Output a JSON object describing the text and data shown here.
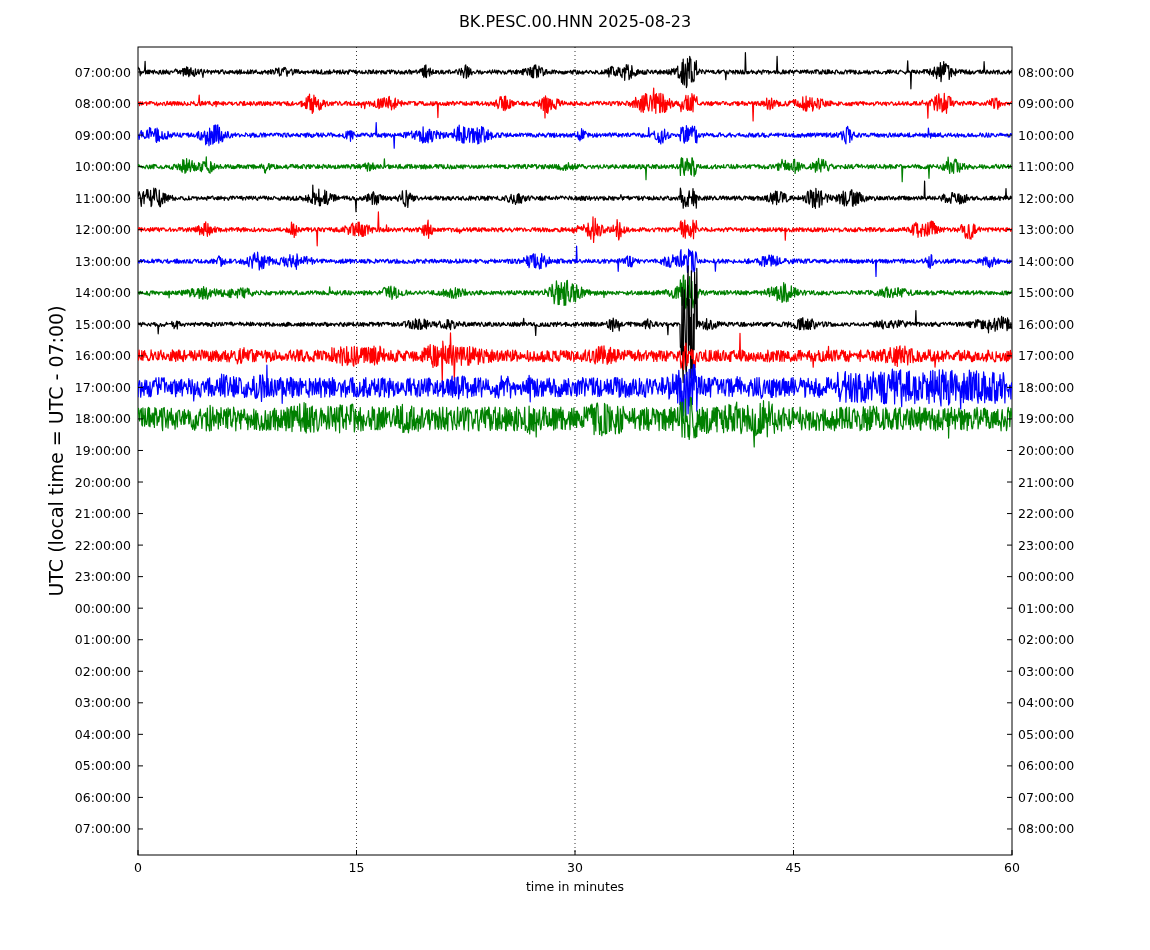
{
  "title": "BK.PESC.00.HNN 2025-08-23",
  "ylabel": "UTC (local time = UTC - 07:00)",
  "xlabel": "time in minutes",
  "xticks": [
    "0",
    "15",
    "30",
    "45",
    "60"
  ],
  "left_labels": [
    "07:00:00",
    "08:00:00",
    "09:00:00",
    "10:00:00",
    "11:00:00",
    "12:00:00",
    "13:00:00",
    "14:00:00",
    "15:00:00",
    "16:00:00",
    "17:00:00",
    "18:00:00",
    "19:00:00",
    "20:00:00",
    "21:00:00",
    "22:00:00",
    "23:00:00",
    "00:00:00",
    "01:00:00",
    "02:00:00",
    "03:00:00",
    "04:00:00",
    "05:00:00",
    "06:00:00",
    "07:00:00"
  ],
  "right_labels": [
    "08:00:00",
    "09:00:00",
    "10:00:00",
    "11:00:00",
    "12:00:00",
    "13:00:00",
    "14:00:00",
    "15:00:00",
    "16:00:00",
    "17:00:00",
    "18:00:00",
    "19:00:00",
    "20:00:00",
    "21:00:00",
    "22:00:00",
    "23:00:00",
    "00:00:00",
    "01:00:00",
    "02:00:00",
    "03:00:00",
    "04:00:00",
    "05:00:00",
    "06:00:00",
    "07:00:00",
    "08:00:00"
  ],
  "traces": [
    {
      "color": "#000000"
    },
    {
      "color": "#ff0000"
    },
    {
      "color": "#0000ff"
    },
    {
      "color": "#008000"
    },
    {
      "color": "#000000"
    },
    {
      "color": "#ff0000"
    },
    {
      "color": "#0000ff"
    },
    {
      "color": "#008000"
    },
    {
      "color": "#000000"
    },
    {
      "color": "#ff0000"
    },
    {
      "color": "#0000ff"
    },
    {
      "color": "#008000"
    }
  ]
}
